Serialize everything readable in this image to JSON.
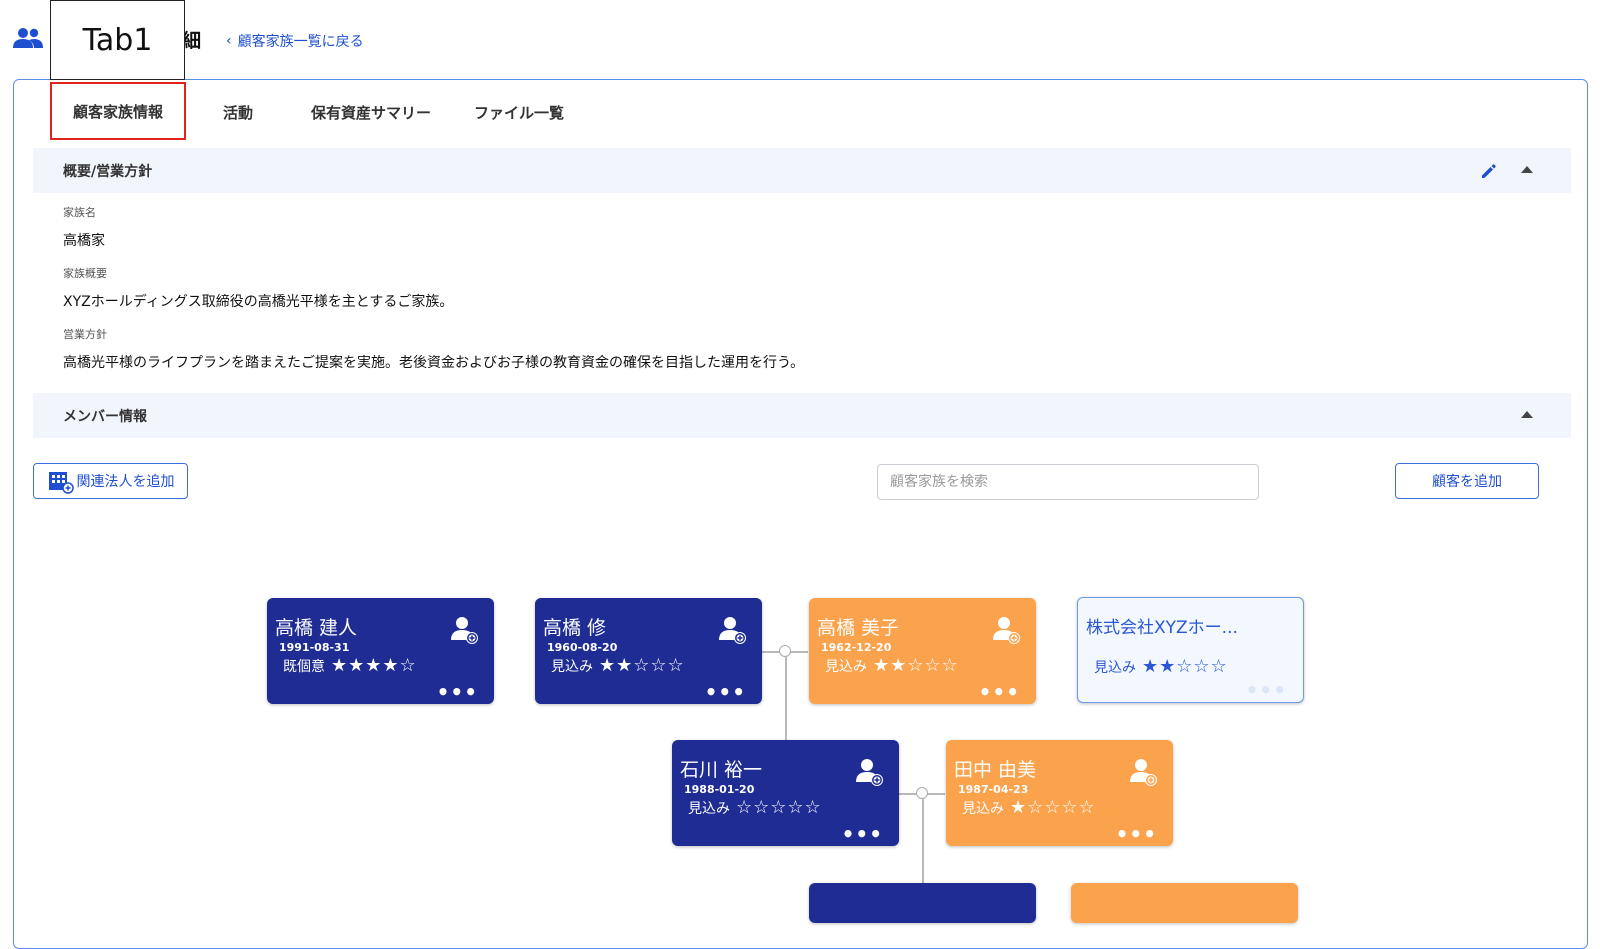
{
  "header": {
    "callout_label": "Tab1",
    "title_tail": "細",
    "back_link": "顧客家族一覧に戻る"
  },
  "tabs": [
    {
      "label": "顧客家族情報",
      "active": true
    },
    {
      "label": "活動"
    },
    {
      "label": "保有資産サマリー"
    },
    {
      "label": "ファイル一覧"
    }
  ],
  "overview": {
    "title": "概要/営業方針",
    "fields": [
      {
        "label": "家族名",
        "value": "高橋家"
      },
      {
        "label": "家族概要",
        "value": "XYZホールディングス取締役の高橋光平様を主とするご家族。"
      },
      {
        "label": "営業方針",
        "value": "高橋光平様のライフプランを踏まえたご提案を実施。老後資金およびお子様の教育資金の確保を目指した運用を行う。"
      }
    ]
  },
  "members_section": {
    "title": "メンバー情報",
    "add_corp_button": "関連法人を追加",
    "search_placeholder": "顧客家族を検索",
    "add_customer_button": "顧客を追加"
  },
  "members": [
    {
      "name": "高橋 建人",
      "date": "1991-08-31",
      "status": "既個意",
      "stars": "★★★★☆",
      "style": "navy"
    },
    {
      "name": "高橋 修",
      "date": "1960-08-20",
      "status": "見込み",
      "stars": "★★☆☆☆",
      "style": "navy"
    },
    {
      "name": "高橋 美子",
      "date": "1962-12-20",
      "status": "見込み",
      "stars": "★★☆☆☆",
      "style": "orange"
    },
    {
      "name": "株式会社XYZホー...",
      "status": "見込み",
      "stars": "★★☆☆☆",
      "style": "corp"
    },
    {
      "name": "石川 裕一",
      "date": "1988-01-20",
      "status": "見込み",
      "stars": "☆☆☆☆☆",
      "style": "navy"
    },
    {
      "name": "田中 由美",
      "date": "1987-04-23",
      "status": "見込み",
      "stars": "★☆☆☆☆",
      "style": "orange"
    }
  ],
  "colors": {
    "navy_card": "#1e2c94",
    "orange_card": "#fba24c",
    "accent_blue": "#1f4fd1",
    "active_tab_outline": "#e0231c"
  },
  "icons": [
    "people-icon",
    "edit-pencil-icon",
    "collapse-caret-icon",
    "building-add-icon",
    "person-add-icon",
    "more-dots-icon"
  ]
}
